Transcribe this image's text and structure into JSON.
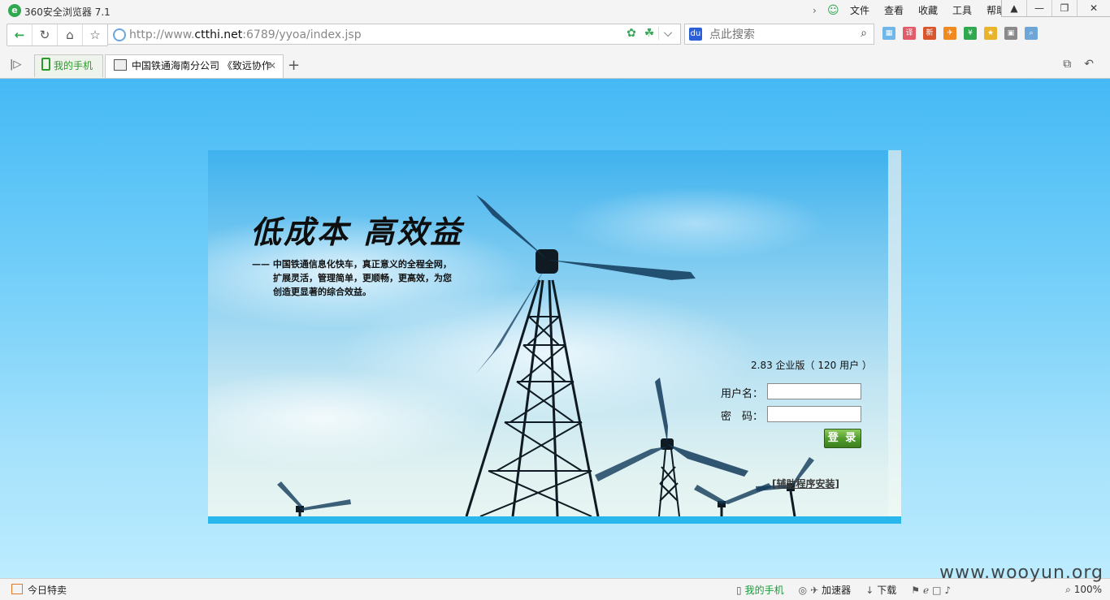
{
  "browser": {
    "title": "360安全浏览器 7.1",
    "menu": [
      "文件",
      "查看",
      "收藏",
      "工具",
      "帮助"
    ],
    "address": {
      "url_prefix": "http://www.",
      "url_host": "ctthi.net",
      "url_suffix": ":6789/yyoa/index.jsp"
    },
    "search": {
      "placeholder": "点此搜索"
    },
    "tabs": {
      "phone_tab": "我的手机",
      "active_tab": "中国铁通海南分公司 《致远协作",
      "add": "+"
    }
  },
  "page": {
    "slogan": {
      "title": "低成本  高效益",
      "line1": "—— 中国铁通信息化快车，真正意义的全程全网，",
      "line2": "扩展灵活，管理简单，更顺畅，更高效，为您",
      "line3": "创造更显著的综合效益。"
    },
    "login": {
      "version": "2.83 企业版（ 120 用户 ）",
      "username_label": "用户名：",
      "password_label": "密　码：",
      "username_value": "",
      "password_value": "",
      "submit_label": "登 录",
      "helper_link": "[辅助程序安装]"
    }
  },
  "statusbar": {
    "deal": "今日特卖",
    "phone": "我的手机",
    "accelerator": "加速器",
    "download": "下载",
    "zoom": "100%"
  },
  "watermark": "www.wooyun.org",
  "colors": {
    "page_background_top": "#45b9f5",
    "page_background_bottom": "#bcecfe",
    "login_button": "#4e9a2c",
    "brand_green": "#2fa84f"
  }
}
